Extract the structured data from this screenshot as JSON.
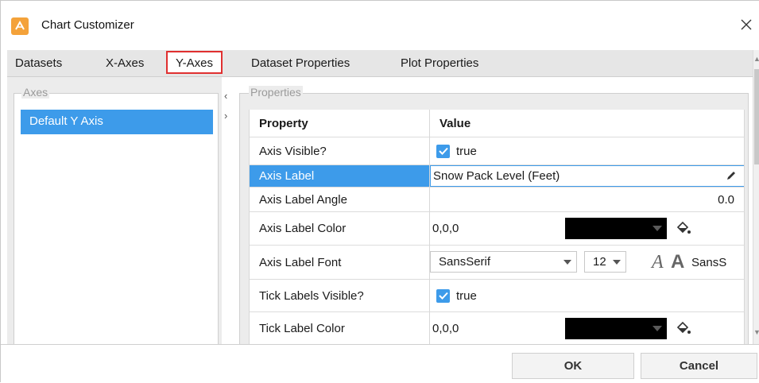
{
  "window": {
    "title": "Chart Customizer"
  },
  "tabs": [
    "Datasets",
    "X-Axes",
    "Y-Axes",
    "Dataset Properties",
    "Plot Properties"
  ],
  "axes_panel": {
    "legend": "Axes",
    "items": [
      "Default Y Axis"
    ]
  },
  "properties_panel": {
    "legend": "Properties",
    "columns": {
      "property": "Property",
      "value": "Value"
    },
    "rows": {
      "axis_visible": {
        "property": "Axis Visible?",
        "value": "true"
      },
      "axis_label": {
        "property": "Axis Label",
        "value": "Snow Pack Level (Feet)"
      },
      "axis_label_angle": {
        "property": "Axis Label Angle",
        "value": "0.0"
      },
      "axis_label_color": {
        "property": "Axis Label Color",
        "value": "0,0,0",
        "swatch": "#000000"
      },
      "axis_label_font": {
        "property": "Axis Label Font",
        "family": "SansSerif",
        "size": "12",
        "preview": "SansS"
      },
      "tick_labels_visible": {
        "property": "Tick Labels Visible?",
        "value": "true"
      },
      "tick_label_color": {
        "property": "Tick Label Color",
        "value": "0,0,0",
        "swatch": "#000000"
      }
    }
  },
  "buttons": {
    "ok": "OK",
    "cancel": "Cancel"
  },
  "colors": {
    "accent": "#3d9bea",
    "tab_highlight": "#e03030",
    "icon": "#f4a23a"
  }
}
